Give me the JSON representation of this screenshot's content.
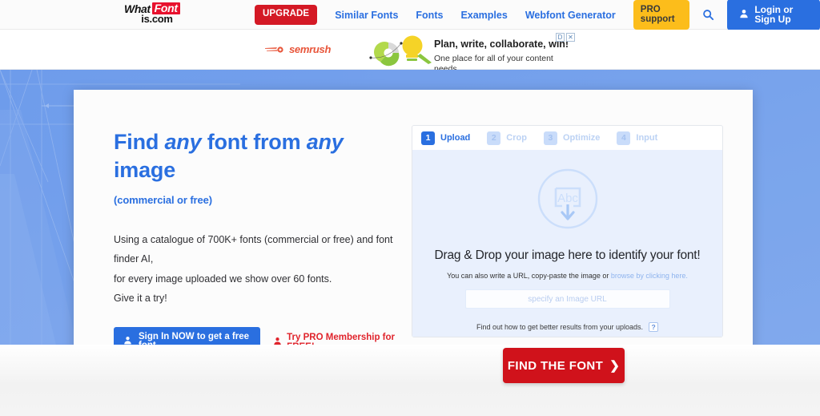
{
  "header": {
    "logo": {
      "what": "What",
      "font": "Font",
      "domain": "is.com"
    },
    "upgrade_label": "UPGRADE",
    "nav_links": [
      {
        "label": "Similar Fonts"
      },
      {
        "label": "Fonts"
      },
      {
        "label": "Examples"
      },
      {
        "label": "Webfont Generator"
      }
    ],
    "pro_label": "PRO support",
    "search_icon": "search-icon",
    "login_label": "Login or Sign Up",
    "colors": {
      "upgrade_red": "#d41925",
      "pro_yellow": "#fcbd1b",
      "link_blue": "#2a6fe0"
    }
  },
  "ad": {
    "brand": "semrush",
    "headline": "Plan, write, collaborate, win!",
    "subline": "One place for all of your content needs",
    "choices_label": "D",
    "close_label": "✕"
  },
  "hero": {
    "title_part1": "Find ",
    "title_em1": "any",
    "title_part2": " font from ",
    "title_em2": "any",
    "title_part3": " image",
    "subtitle": "(commercial or free)",
    "body_line1": "Using a catalogue of 700K+ fonts (commercial or free) and font finder AI,",
    "body_line2": "for every image uploaded we show over 60 fonts.",
    "body_line3": "Give it a try!",
    "signin_label": "Sign In NOW to get a free font",
    "pro_link_label": "Try PRO Membership for FREE!",
    "background_color": "#7aa3ec"
  },
  "upload_panel": {
    "steps": [
      {
        "num": "1",
        "label": "Upload",
        "active": true
      },
      {
        "num": "2",
        "label": "Crop",
        "active": false
      },
      {
        "num": "3",
        "label": "Optimize",
        "active": false
      },
      {
        "num": "4",
        "label": "Input",
        "active": false
      }
    ],
    "drop_icon": "image-upload-icon",
    "drop_icon_text": "Abc",
    "drop_title": "Drag & Drop your image here to identify your font!",
    "drop_sub_text": "You can also write a URL, copy-paste the image or ",
    "drop_sub_link": "browse by clicking here.",
    "url_placeholder": "specify an Image URL",
    "url_value": "",
    "footer_text": "Find out how to get better results from your uploads.",
    "help_badge": "?"
  },
  "find_button": {
    "label": "FIND THE FONT",
    "chevron": "❯",
    "color": "#d0121b"
  }
}
